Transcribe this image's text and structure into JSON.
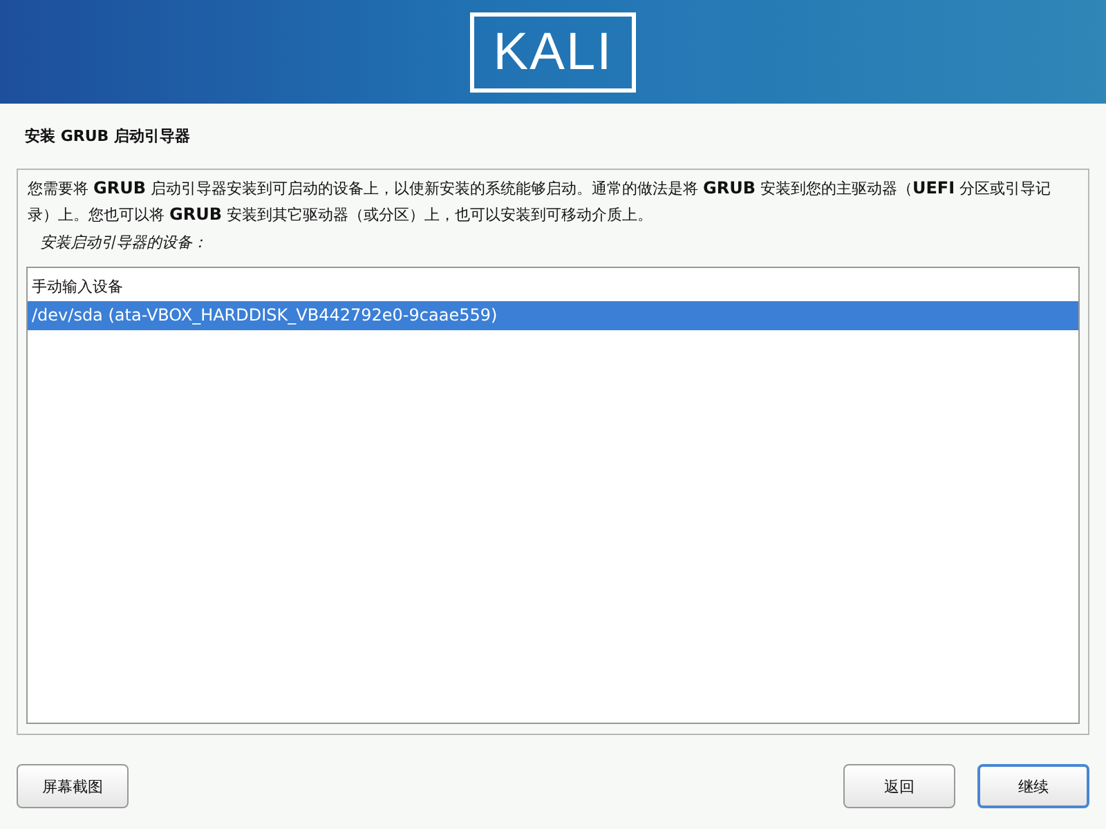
{
  "header": {
    "logo": "KALI"
  },
  "title": "安装 GRUB 启动引导器",
  "description": "您需要将 **GRUB** 启动引导器安装到可启动的设备上，以使新安装的系统能够启动。通常的做法是将 **GRUB** 安装到您的主驱动器（**UEFI** 分区或引导记录）上。您也可以将 **GRUB** 安装到其它驱动器（或分区）上，也可以安装到可移动介质上。",
  "prompt": "安装启动引导器的设备：",
  "devices": [
    {
      "label": "手动输入设备",
      "selected": false
    },
    {
      "label": "/dev/sda  (ata-VBOX_HARDDISK_VB442792e0-9caae559)",
      "selected": true
    }
  ],
  "left_buttons": [
    {
      "label": "屏幕截图",
      "focused": false
    }
  ],
  "right_buttons": [
    {
      "label": "返回",
      "focused": false
    },
    {
      "label": "继续",
      "focused": true
    }
  ]
}
